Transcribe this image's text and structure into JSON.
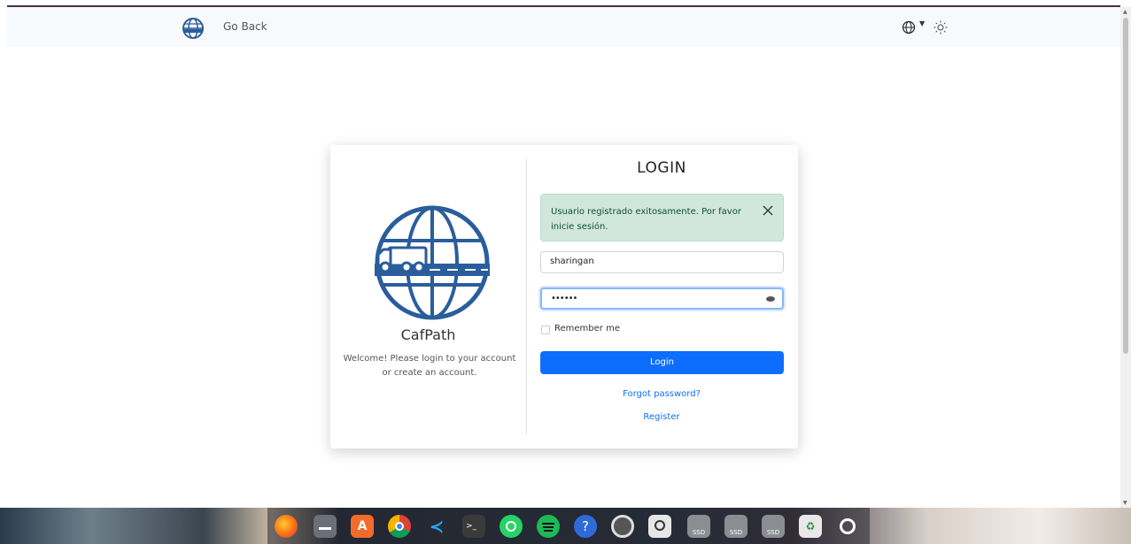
{
  "nav": {
    "back_label": "Go Back",
    "icons": [
      "globe-logo-icon",
      "globe-icon",
      "caret-down-icon",
      "sun-icon"
    ]
  },
  "brand": {
    "name": "CafPath",
    "welcome": "Welcome! Please login to your account or create an account."
  },
  "login": {
    "title": "LOGIN",
    "alert": "Usuario registrado exitosamente. Por favor inicie sesión.",
    "username_value": "sharingan",
    "password_dots": "••••••",
    "remember_label": "Remember me",
    "login_button": "Login",
    "forgot_link": "Forgot password?",
    "register_link": "Register"
  },
  "taskbar": {
    "icons": [
      "firefox-icon",
      "files-icon",
      "app-center-icon",
      "chrome-icon",
      "vscode-icon",
      "terminal-icon",
      "whatsapp-icon",
      "spotify-icon",
      "help-icon",
      "settings-icon",
      "screenshot-icon",
      "ssd-drive-icon",
      "ssd-drive-icon",
      "ssd-drive-icon",
      "trash-icon",
      "ubuntu-icon"
    ],
    "ssd_label": "SSD"
  },
  "colors": {
    "primary": "#0d6efd",
    "alert_bg": "#d1e7dd",
    "logo_blue": "#2a5d9c"
  }
}
